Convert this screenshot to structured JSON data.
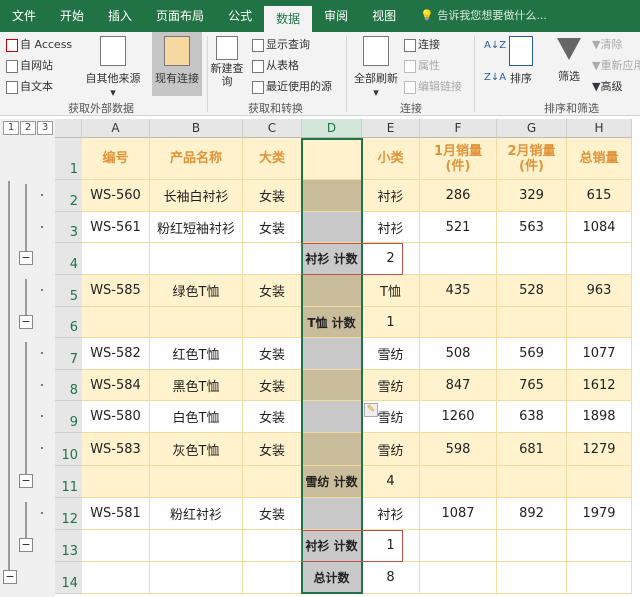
{
  "tabs": [
    "文件",
    "开始",
    "插入",
    "页面布局",
    "公式",
    "数据",
    "审阅",
    "视图"
  ],
  "active_tab": "数据",
  "tell_me": "告诉我您想要做什么...",
  "ribbon": {
    "from_access": "自 Access",
    "from_web": "自网站",
    "from_text": "自文本",
    "from_other": "自其他来源",
    "existing": "现有连接",
    "new_query": "新建查询",
    "show_query": "显示查询",
    "from_table": "从表格",
    "recent_sources": "最近使用的源",
    "refresh_all": "全部刷新",
    "connections": "连接",
    "properties": "属性",
    "edit_links": "编辑链接",
    "sort": "排序",
    "filter": "筛选",
    "clear": "清除",
    "reapply": "重新应用",
    "advanced": "高级",
    "groups": [
      "获取外部数据",
      "获取和转换",
      "连接",
      "排序和筛选"
    ]
  },
  "outline_levels": [
    "1",
    "2",
    "3"
  ],
  "columns": [
    "A",
    "B",
    "C",
    "D",
    "E",
    "F",
    "G",
    "H"
  ],
  "headers": [
    "编号",
    "产品名称",
    "大类",
    "",
    "小类",
    "1月销量(件)",
    "2月销量(件)",
    "总销量"
  ],
  "rows": [
    {
      "n": "2",
      "v": [
        "WS-560",
        "长袖白衬衫",
        "女装",
        "",
        "衬衫",
        "286",
        "329",
        "615"
      ]
    },
    {
      "n": "3",
      "v": [
        "WS-561",
        "粉红短袖衬衫",
        "女装",
        "",
        "衬衫",
        "521",
        "563",
        "1084"
      ]
    },
    {
      "n": "4",
      "v": [
        "",
        "",
        "",
        "衬衫 计数",
        "2",
        "",
        "",
        ""
      ]
    },
    {
      "n": "5",
      "v": [
        "WS-585",
        "绿色T恤",
        "女装",
        "",
        "T恤",
        "435",
        "528",
        "963"
      ]
    },
    {
      "n": "6",
      "v": [
        "",
        "",
        "",
        "T恤 计数",
        "1",
        "",
        "",
        ""
      ]
    },
    {
      "n": "7",
      "v": [
        "WS-582",
        "红色T恤",
        "女装",
        "",
        "雪纺",
        "508",
        "569",
        "1077"
      ]
    },
    {
      "n": "8",
      "v": [
        "WS-584",
        "黑色T恤",
        "女装",
        "",
        "雪纺",
        "847",
        "765",
        "1612"
      ]
    },
    {
      "n": "9",
      "v": [
        "WS-580",
        "白色T恤",
        "女装",
        "",
        "雪纺",
        "1260",
        "638",
        "1898"
      ]
    },
    {
      "n": "10",
      "v": [
        "WS-583",
        "灰色T恤",
        "女装",
        "",
        "雪纺",
        "598",
        "681",
        "1279"
      ]
    },
    {
      "n": "11",
      "v": [
        "",
        "",
        "",
        "雪纺 计数",
        "4",
        "",
        "",
        ""
      ]
    },
    {
      "n": "12",
      "v": [
        "WS-581",
        "粉红衬衫",
        "女装",
        "",
        "衬衫",
        "1087",
        "892",
        "1979"
      ]
    },
    {
      "n": "13",
      "v": [
        "",
        "",
        "",
        "衬衫 计数",
        "1",
        "",
        "",
        ""
      ]
    },
    {
      "n": "14",
      "v": [
        "",
        "",
        "",
        "总计数",
        "8",
        "",
        "",
        ""
      ]
    }
  ],
  "colors": {
    "accent": "#217346",
    "row_yellow": "#fff2cc",
    "d_tan": "#c9bc9a",
    "d_grey": "#c9c9c9",
    "header_text": "#e0943a",
    "highlight_box": "#c0504d"
  }
}
